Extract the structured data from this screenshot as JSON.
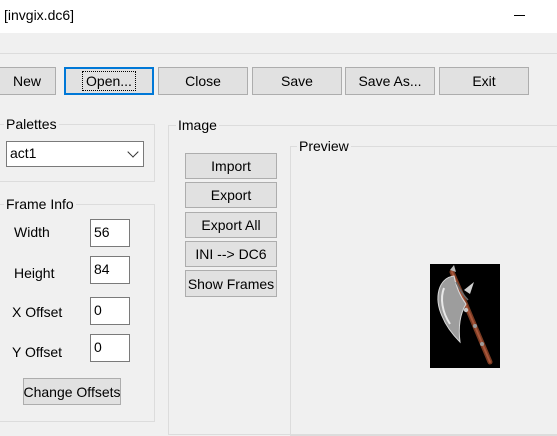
{
  "window": {
    "title": "[invgix.dc6]"
  },
  "toolbar": {
    "new": "New",
    "open": "Open...",
    "close": "Close",
    "save": "Save",
    "save_as": "Save As...",
    "exit": "Exit"
  },
  "palettes": {
    "legend": "Palettes",
    "selected": "act1"
  },
  "frame_info": {
    "legend": "Frame Info",
    "width_label": "Width",
    "width_value": "56",
    "height_label": "Height",
    "height_value": "84",
    "x_offset_label": "X Offset",
    "x_offset_value": "0",
    "y_offset_label": "Y Offset",
    "y_offset_value": "0",
    "change_offsets": "Change Offsets"
  },
  "image": {
    "legend": "Image",
    "import": "Import",
    "export": "Export",
    "export_all": "Export All",
    "ini_to_dc6": "INI --> DC6",
    "show_frames": "Show Frames"
  },
  "preview": {
    "legend": "Preview",
    "icon": "axe-sprite"
  }
}
